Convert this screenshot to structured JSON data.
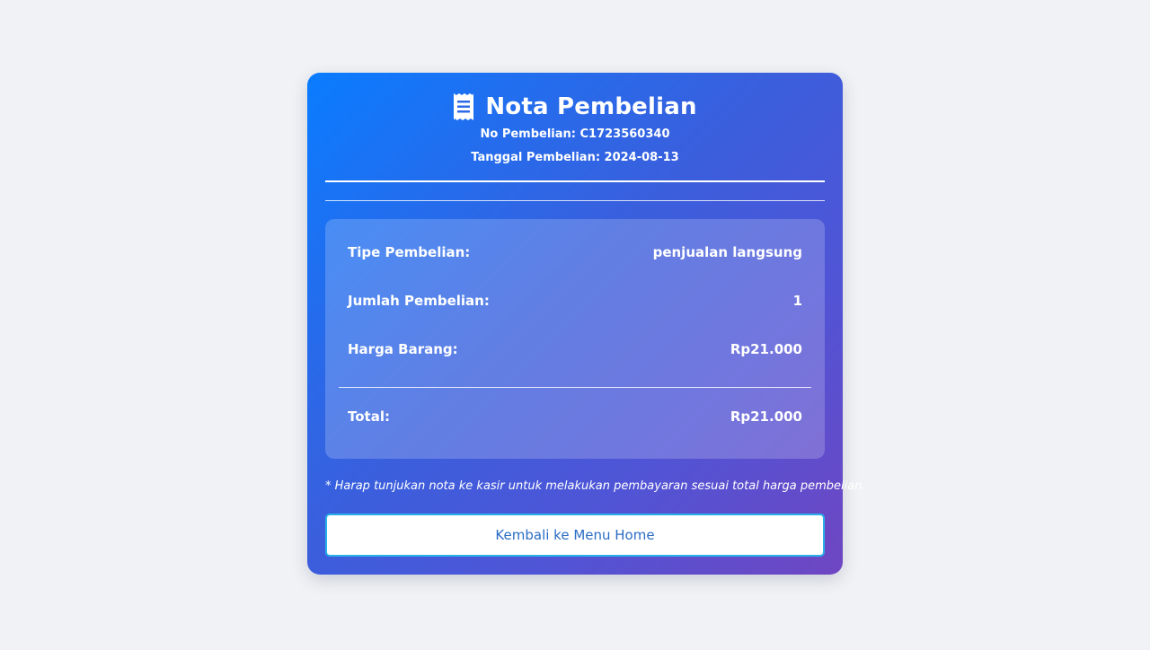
{
  "receipt": {
    "title": "Nota Pembelian",
    "icon": "receipt-icon",
    "purchase_no": "No Pembelian: C1723560340",
    "purchase_date": "Tanggal Pembelian: 2024-08-13"
  },
  "details": [
    {
      "label": "Tipe Pembelian:",
      "value": "penjualan langsung"
    },
    {
      "label": "Jumlah Pembelian:",
      "value": "1"
    },
    {
      "label": "Harga Barang:",
      "value": "Rp21.000"
    }
  ],
  "total": {
    "label": "Total:",
    "value": "Rp21.000"
  },
  "note": "* Harap tunjukan nota ke kasir untuk melakukan pembayaran sesuai total harga pembelian.",
  "back_button": {
    "label": "Kembali ke Menu Home"
  },
  "colors": {
    "page_bg": "#f0f2f5",
    "card_gradient_start": "#0a7cff",
    "card_gradient_end": "#6f46c2",
    "button_text": "#2b6cc4",
    "button_border": "#2ab0e8"
  }
}
